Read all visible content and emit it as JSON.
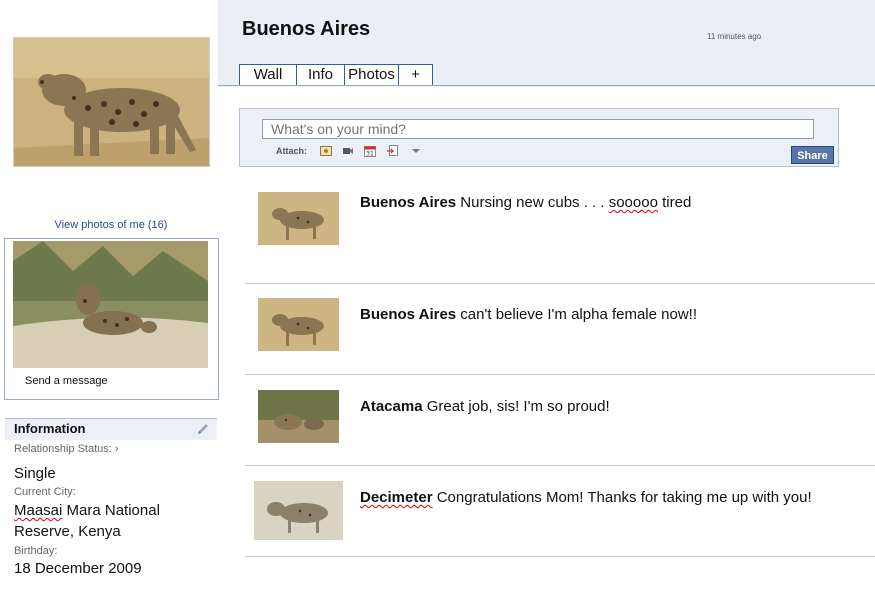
{
  "profile": {
    "name": "Buenos Aires",
    "status_time": "11 minutes ago"
  },
  "tabs": [
    {
      "label": "Wall"
    },
    {
      "label": "Info"
    },
    {
      "label": "Photos"
    },
    {
      "label": "+"
    }
  ],
  "sidebar": {
    "view_photos": "View photos of me (16)",
    "send_message": "Send a message",
    "information": {
      "title": "Information",
      "relationship_label": "Relationship Status: ›",
      "relationship_value": "Single",
      "city_label": "Current City:",
      "city_value_line1_underlined": "Maasai",
      "city_value_line1_rest": " Mara National",
      "city_value_line2": "Reserve, Kenya",
      "birthday_label": "Birthday:",
      "birthday_value": "18 December 2009"
    }
  },
  "composer": {
    "placeholder": "What's on your mind?",
    "attach_label": "Attach:",
    "share_label": "Share",
    "attach_icons": [
      "photo-icon",
      "video-icon",
      "event-icon",
      "link-icon",
      "dropdown-arrow-icon"
    ]
  },
  "feed": [
    {
      "author": "Buenos Aires",
      "text_before": " Nursing new cubs . . . ",
      "text_underlined": "sooooo",
      "text_after": " tired"
    },
    {
      "author": "Buenos Aires",
      "text_before": " can't believe I'm alpha female now!!",
      "text_underlined": "",
      "text_after": ""
    },
    {
      "author": "Atacama",
      "text_before": " Great job, sis! I'm so proud!",
      "text_underlined": "",
      "text_after": ""
    },
    {
      "author": "Decimeter",
      "text_before": " Congratulations Mom! Thanks for taking me up with you!",
      "text_underlined": "",
      "text_after": ""
    }
  ],
  "colors": {
    "brand": "#3b5998",
    "header_bg": "#eceef5",
    "link": "#2d4c8a",
    "share_button": "#5b74a8"
  }
}
